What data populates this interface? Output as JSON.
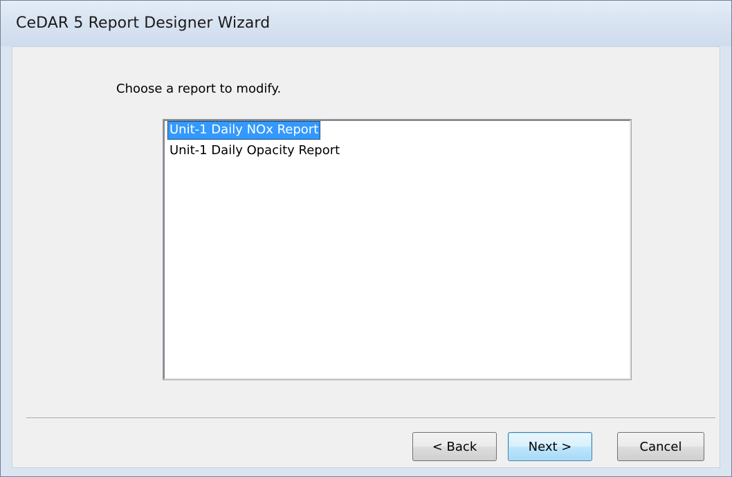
{
  "window": {
    "title": "CeDAR 5 Report Designer Wizard"
  },
  "wizard": {
    "prompt": "Choose a report to modify.",
    "reports": [
      {
        "label": "Unit-1 Daily NOx Report",
        "selected": true
      },
      {
        "label": "Unit-1 Daily Opacity Report",
        "selected": false
      }
    ]
  },
  "buttons": {
    "back_label": "< Back",
    "next_label": "Next >",
    "cancel_label": "Cancel"
  },
  "colors": {
    "selection": "#3399ff",
    "titlebar": "#dbe5f1",
    "dialog_face": "#f0f0f0"
  }
}
